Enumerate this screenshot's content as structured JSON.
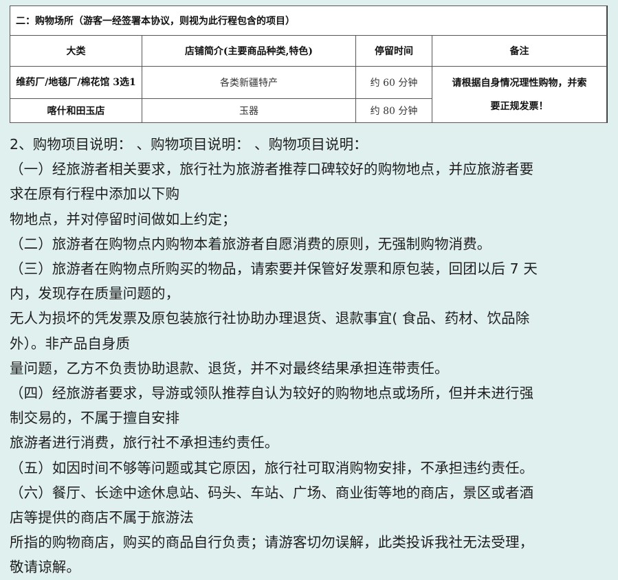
{
  "table": {
    "caption": "二：购物场所（游客一经签署本协议，则视为此行程包含的项目）",
    "headers": [
      "大类",
      "店铺简介(主要商品种类,特色)",
      "停留时间",
      "备注"
    ],
    "rows": [
      {
        "category": "维药厂/地毯厂/棉花馆 3选1",
        "desc": "各类新疆特产",
        "stay": "约 60 分钟"
      },
      {
        "category": "喀什和田玉店",
        "desc": "玉器",
        "stay": "约 80 分钟"
      }
    ],
    "note_line1": "请根据自身情况理性购物，并索",
    "note_line2": "要正规发票！"
  },
  "body": {
    "lines": [
      "2、购物项目说明：  、购物项目说明：  、购物项目说明：",
      "（一）经旅游者相关要求，旅行社为旅游者推荐口碑较好的购物地点，并应旅游者要",
      "求在原有行程中添加以下购",
      "物地点，并对停留时间做如上约定；",
      "（二）旅游者在购物点内购物本着旅游者自愿消费的原则，无强制购物消费。",
      "（三）旅游者在购物点所购买的物品，请索要并保管好发票和原包装，回团以后 7 天",
      "内，发现存在质量问题的，",
      "无人为损坏的凭发票及原包装旅行社协助办理退货、退款事宜( 食品、药材、饮品除",
      "外）。非产品自身质",
      "量问题，乙方不负责协助退款、退货，并不对最终结果承担连带责任。",
      "（四）经旅游者要求，导游或领队推荐自认为较好的购物地点或场所，但并未进行强",
      "制交易的，不属于擅自安排",
      "旅游者进行消费，旅行社不承担违约责任。",
      "（五）如因时间不够等问题或其它原因，旅行社可取消购物安排，不承担违约责任。",
      "（六）餐厅、长途中途休息站、码头、车站、广场、商业街等地的商店，景区或者酒",
      "店等提供的商店不属于旅游法",
      "所指的购物商店，购买的商品自行负责；请游客切勿误解，此类投诉我社无法受理，",
      "敬请谅解。"
    ]
  }
}
